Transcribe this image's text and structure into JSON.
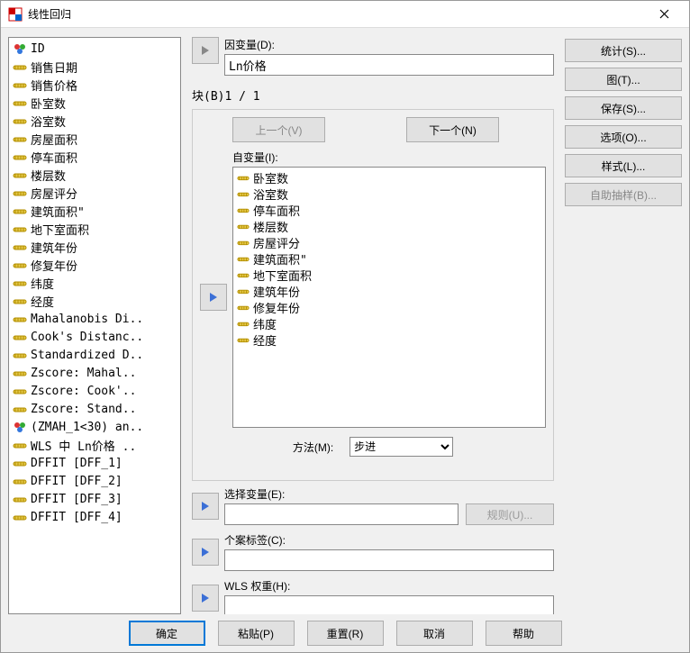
{
  "window": {
    "title": "线性回归"
  },
  "left_vars": [
    {
      "name": "ID",
      "type": "nom"
    },
    {
      "name": "销售日期",
      "type": "scale"
    },
    {
      "name": "销售价格",
      "type": "scale"
    },
    {
      "name": "卧室数",
      "type": "scale"
    },
    {
      "name": "浴室数",
      "type": "scale"
    },
    {
      "name": "房屋面积",
      "type": "scale"
    },
    {
      "name": "停车面积",
      "type": "scale"
    },
    {
      "name": "楼层数",
      "type": "scale"
    },
    {
      "name": "房屋评分",
      "type": "scale"
    },
    {
      "name": "建筑面积\"",
      "type": "scale"
    },
    {
      "name": "地下室面积",
      "type": "scale"
    },
    {
      "name": "建筑年份",
      "type": "scale"
    },
    {
      "name": "修复年份",
      "type": "scale"
    },
    {
      "name": "纬度",
      "type": "scale"
    },
    {
      "name": "经度",
      "type": "scale"
    },
    {
      "name": "Mahalanobis Di..",
      "type": "scale"
    },
    {
      "name": "Cook's Distanc..",
      "type": "scale"
    },
    {
      "name": "Standardized D..",
      "type": "scale"
    },
    {
      "name": "Zscore:  Mahal..",
      "type": "scale"
    },
    {
      "name": "Zscore:  Cook'..",
      "type": "scale"
    },
    {
      "name": "Zscore:  Stand..",
      "type": "scale"
    },
    {
      "name": "(ZMAH_1<30) an..",
      "type": "nom"
    },
    {
      "name": "WLS 中 Ln价格 ..",
      "type": "scale"
    },
    {
      "name": "DFFIT [DFF_1]",
      "type": "scale"
    },
    {
      "name": "DFFIT [DFF_2]",
      "type": "scale"
    },
    {
      "name": "DFFIT [DFF_3]",
      "type": "scale"
    },
    {
      "name": "DFFIT [DFF_4]",
      "type": "scale"
    }
  ],
  "labels": {
    "dependent": "因变量(D):",
    "block": "块(B)1 / 1",
    "prev": "上一个(V)",
    "next": "下一个(N)",
    "independent": "自变量(I):",
    "method": "方法(M):",
    "select_var": "选择变量(E):",
    "rule": "规则(U)...",
    "case_label": "个案标签(C):",
    "wls": "WLS 权重(H):"
  },
  "dependent_value": "Ln价格",
  "independent_vars": [
    "卧室数",
    "浴室数",
    "停车面积",
    "楼层数",
    "房屋评分",
    "建筑面积\"",
    "地下室面积",
    "建筑年份",
    "修复年份",
    "纬度",
    "经度"
  ],
  "method_value": "步进",
  "select_value": "",
  "case_value": "",
  "wls_value": "",
  "side_buttons": {
    "stats": "统计(S)...",
    "plots": "图(T)...",
    "save": "保存(S)...",
    "options": "选项(O)...",
    "style": "样式(L)...",
    "bootstrap": "自助抽样(B)..."
  },
  "footer": {
    "ok": "确定",
    "paste": "粘贴(P)",
    "reset": "重置(R)",
    "cancel": "取消",
    "help": "帮助"
  }
}
